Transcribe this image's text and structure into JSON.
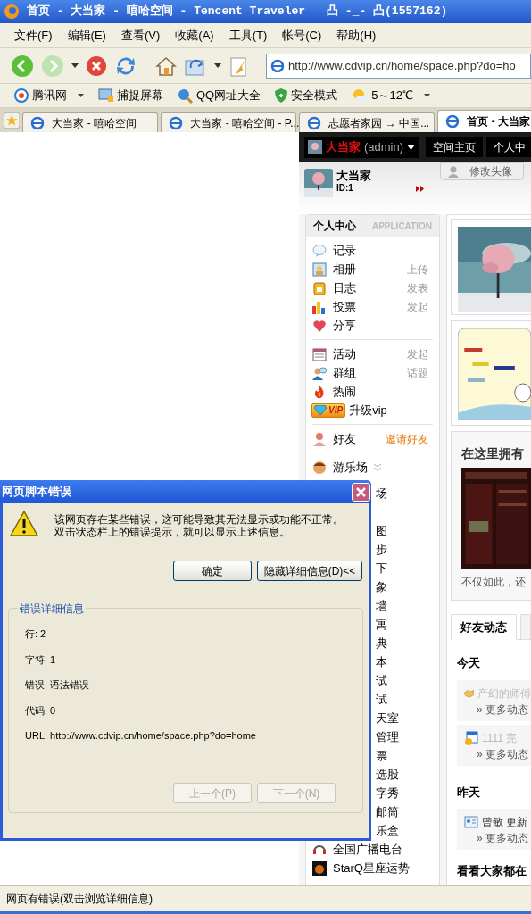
{
  "window": {
    "title": "首页 - 大当家 - 嘻哈空间 - Tencent Traveler",
    "user": "凸 -_- 凸(1557162)"
  },
  "menu": [
    "文件(F)",
    "编辑(E)",
    "查看(V)",
    "收藏(A)",
    "工具(T)",
    "帐号(C)",
    "帮助(H)"
  ],
  "address": "http://www.cdvip.cn/home/space.php?do=ho",
  "links": [
    {
      "label": "腾讯网",
      "dropdown": true
    },
    {
      "label": "捕捉屏幕",
      "dropdown": false
    },
    {
      "label": "QQ网址大全",
      "dropdown": false
    },
    {
      "label": "安全模式",
      "dropdown": false
    },
    {
      "label": "5～12℃",
      "dropdown": true
    }
  ],
  "tabs": [
    {
      "label": "大当家 - 嘻哈空间",
      "selected": false
    },
    {
      "label": "大当家 - 嘻哈空间 - P...",
      "selected": false
    },
    {
      "label": "志愿者家园 → 中国...",
      "selected": false
    },
    {
      "label": "首页 - 大当家",
      "selected": true
    }
  ],
  "page": {
    "topbar": {
      "user": "大当家",
      "account": "(admin)",
      "links": [
        "空间主页",
        "个人中"
      ]
    },
    "profile": {
      "name": "大当家",
      "id": "ID:1",
      "avatar_button": "修改头像"
    },
    "sidebar": {
      "title": "个人中心",
      "subtitle": "APPLICATION",
      "sections": [
        [
          {
            "kind": "app",
            "label": "记录"
          },
          {
            "kind": "app",
            "label": "相册",
            "action": "上传"
          },
          {
            "kind": "app",
            "label": "日志",
            "action": "发表"
          },
          {
            "kind": "app",
            "label": "投票",
            "action": "发起"
          },
          {
            "kind": "app",
            "label": "分享"
          }
        ],
        [
          {
            "kind": "app",
            "label": "活动",
            "action": "发起"
          },
          {
            "kind": "app",
            "label": "群组",
            "action": "话题"
          },
          {
            "kind": "app",
            "label": "热闹"
          },
          {
            "kind": "vip",
            "badge": "VIP",
            "label": "升级vip"
          }
        ],
        [
          {
            "kind": "app",
            "label": "好友",
            "action": "邀请好友",
            "accent": true
          }
        ],
        [
          {
            "kind": "app",
            "label": "游乐场",
            "expander": true
          },
          {
            "kind": "covered",
            "label": "场",
            "gap_after": true
          },
          {
            "kind": "covered",
            "label": "图"
          },
          {
            "kind": "covered",
            "label": "步"
          },
          {
            "kind": "covered",
            "label": "下"
          },
          {
            "kind": "covered",
            "label": "象"
          },
          {
            "kind": "covered",
            "label": "墙"
          },
          {
            "kind": "covered",
            "label": "寓"
          },
          {
            "kind": "covered",
            "label": "典"
          },
          {
            "kind": "covered",
            "label": "本"
          },
          {
            "kind": "covered",
            "label": "试"
          },
          {
            "kind": "covered",
            "label": "试"
          },
          {
            "kind": "covered",
            "label": "天室"
          },
          {
            "kind": "covered",
            "label": "管理"
          },
          {
            "kind": "covered",
            "label": "票"
          },
          {
            "kind": "covered",
            "label": "选股"
          },
          {
            "kind": "covered",
            "label": "字秀"
          },
          {
            "kind": "covered",
            "label": "邮筒"
          },
          {
            "kind": "covered",
            "label": "乐盒"
          },
          {
            "kind": "app",
            "label": "全国广播电台"
          },
          {
            "kind": "app",
            "label": "StarQ星座运势"
          }
        ]
      ]
    },
    "intro": {
      "heading": "在这里拥有",
      "text": "不仅如此，还"
    },
    "feed": {
      "tabs": [
        {
          "label": "好友动态",
          "selected": true
        }
      ],
      "days": [
        {
          "label": "今天",
          "entries": [
            {
              "text": "产幻的师傅",
              "muted": true,
              "more": "» 更多动态"
            },
            {
              "text": "1111 完",
              "muted": true,
              "more": "» 更多动态"
            }
          ]
        },
        {
          "label": "昨天",
          "entries": [
            {
              "text": "曾敏 更新",
              "muted": false,
              "more": "» 更多动态"
            }
          ]
        }
      ],
      "footer": "看看大家都在"
    }
  },
  "dialog": {
    "title": "网页脚本错误",
    "message": [
      "该网页存在某些错误，这可能导致其无法显示或功能不正常。",
      "双击状态栏上的错误提示，就可以显示上述信息。"
    ],
    "buttons": [
      {
        "label": "确定",
        "disabled": false
      },
      {
        "label": "隐藏详细信息(D)<<",
        "disabled": false
      }
    ],
    "details": {
      "title": "错误详细信息",
      "lines": [
        "行: 2",
        "字符: 1",
        "错误: 语法错误",
        "代码: 0",
        "URL: http://www.cdvip.cn/home/space.php?do=home"
      ],
      "buttons": [
        {
          "label": "上一个(P)",
          "disabled": true
        },
        {
          "label": "下一个(N)",
          "disabled": true
        }
      ]
    }
  },
  "status_bar": "网页有错误(双击浏览详细信息)"
}
